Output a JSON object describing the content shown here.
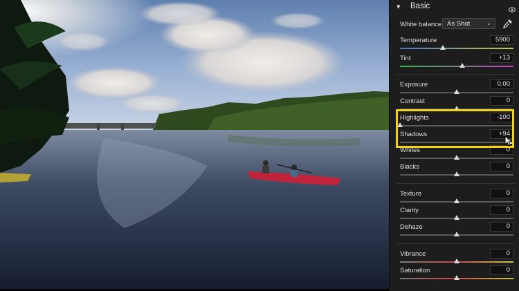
{
  "panel": {
    "title": "Basic",
    "white_balance": {
      "label": "White balance",
      "value": "As Shot"
    },
    "controls": [
      {
        "id": "temperature",
        "label": "Temperature",
        "value": "5900",
        "position": 0.38,
        "track": "temp"
      },
      {
        "id": "tint",
        "label": "Tint",
        "value": "+13",
        "position": 0.55,
        "track": "tint"
      },
      {
        "id": "exposure",
        "label": "Exposure",
        "value": "0.00",
        "position": 0.5,
        "track": "gray"
      },
      {
        "id": "contrast",
        "label": "Contrast",
        "value": "0",
        "position": 0.5,
        "track": "gray"
      },
      {
        "id": "highlights",
        "label": "Highlights",
        "value": "-100",
        "position": 0.0,
        "track": "gray"
      },
      {
        "id": "shadows",
        "label": "Shadows",
        "value": "+94",
        "position": 0.97,
        "track": "gray"
      },
      {
        "id": "whites",
        "label": "Whites",
        "value": "0",
        "position": 0.5,
        "track": "gray"
      },
      {
        "id": "blacks",
        "label": "Blacks",
        "value": "0",
        "position": 0.5,
        "track": "gray"
      },
      {
        "id": "texture",
        "label": "Texture",
        "value": "0",
        "position": 0.5,
        "track": "gray"
      },
      {
        "id": "clarity",
        "label": "Clarity",
        "value": "0",
        "position": 0.5,
        "track": "gray"
      },
      {
        "id": "dehaze",
        "label": "Dehaze",
        "value": "0",
        "position": 0.5,
        "track": "gray"
      },
      {
        "id": "vibrance",
        "label": "Vibrance",
        "value": "0",
        "position": 0.5,
        "track": "color"
      },
      {
        "id": "saturation",
        "label": "Saturation",
        "value": "0",
        "position": 0.5,
        "track": "color"
      }
    ]
  },
  "highlight_color": "#f2d31a",
  "icons": [
    "chevron-down-icon",
    "eye-icon",
    "eyedropper-icon",
    "dropdown-arrow-icon",
    "mouse-cursor-icon"
  ]
}
